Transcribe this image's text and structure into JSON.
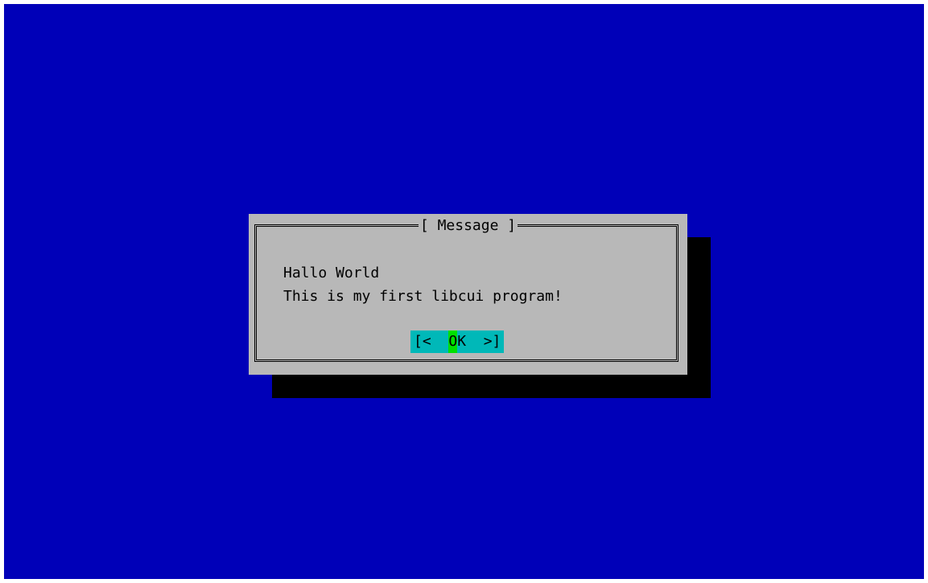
{
  "dialog": {
    "title": "[ Message ]",
    "lines": [
      "Hallo World",
      "This is my first libcui program!"
    ],
    "ok_button": {
      "left_bracket": "[<  ",
      "hotkey": "O",
      "rest": "K  >]"
    }
  },
  "colors": {
    "screen_background": "#0000b8",
    "dialog_background": "#b8b8b8",
    "dialog_shadow": "#000000",
    "button_background": "#00b8b8",
    "button_hotkey": "#00e000"
  }
}
